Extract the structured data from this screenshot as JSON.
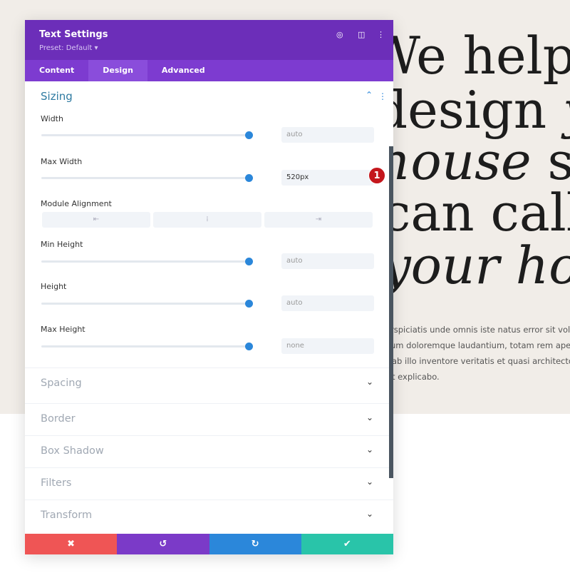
{
  "panel": {
    "title": "Text Settings",
    "preset": "Preset: Default ▾",
    "header_icons": [
      "focus-icon",
      "split-view-icon",
      "more-vertical-icon"
    ],
    "tabs": [
      {
        "label": "Content"
      },
      {
        "label": "Design"
      },
      {
        "label": "Advanced"
      }
    ],
    "active_tab": "Design",
    "sizing": {
      "title": "Sizing",
      "width": {
        "label": "Width",
        "value": "auto"
      },
      "max_width": {
        "label": "Max Width",
        "value": "520px"
      },
      "module_alignment": {
        "label": "Module Alignment",
        "options": [
          "⇤",
          "⁞",
          "⇥"
        ]
      },
      "min_height": {
        "label": "Min Height",
        "value": "auto"
      },
      "height": {
        "label": "Height",
        "value": "auto"
      },
      "max_height": {
        "label": "Max Height",
        "value": "none"
      }
    },
    "badge": "1",
    "sections": [
      {
        "label": "Spacing"
      },
      {
        "label": "Border"
      },
      {
        "label": "Box Shadow"
      },
      {
        "label": "Filters"
      },
      {
        "label": "Transform"
      }
    ],
    "footer": {
      "cancel": "✖",
      "undo": "↺",
      "redo": "↻",
      "save": "✔",
      "colors": {
        "cancel": "#ef5555",
        "undo": "#7b3ac8",
        "redo": "#2b87da",
        "save": "#29c4a9"
      }
    }
  },
  "page": {
    "heading": [
      "We help",
      "design",
      "your",
      "house",
      "so you",
      "can call it",
      "your home"
    ],
    "paragraph": [
      "rspiciatis unde omnis iste natus error sit volu",
      "um doloremque laudantium, totam rem ape",
      "ab illo inventore veritatis et quasi architecto",
      "t explicabo."
    ]
  }
}
